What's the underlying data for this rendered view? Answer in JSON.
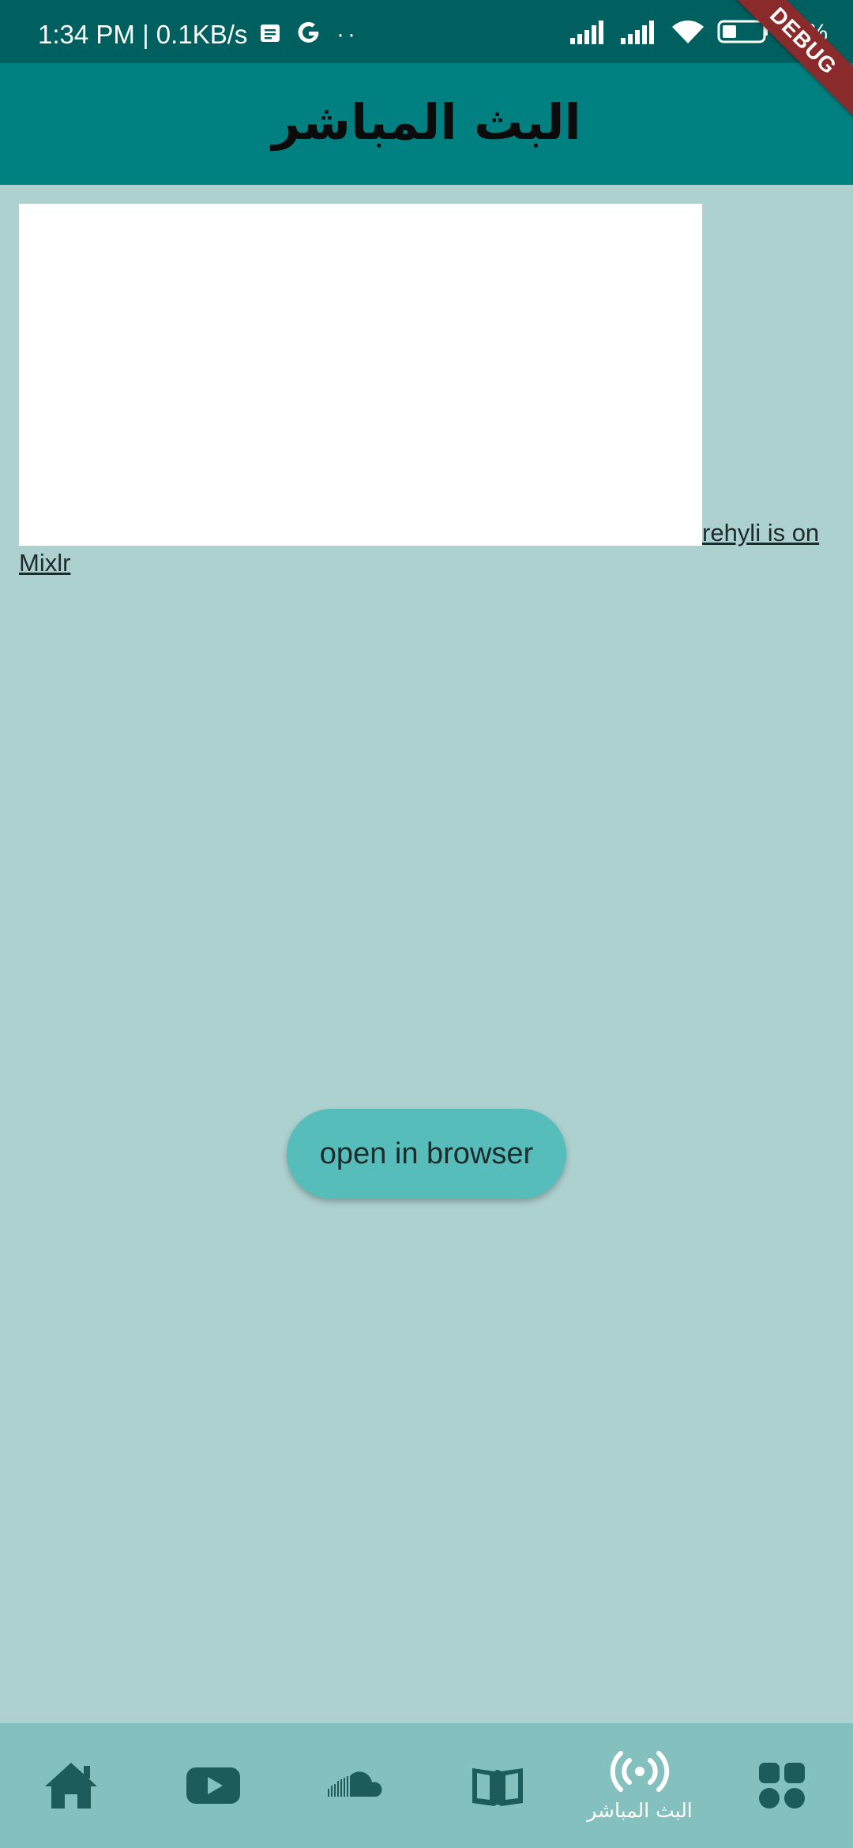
{
  "status_bar": {
    "time_speed": "1:34 PM | 0.1KB/s",
    "left_icons": [
      "message-icon",
      "google-icon",
      "more-dots-icon"
    ],
    "dots": "··",
    "right_icons": [
      "signal-icon",
      "signal-icon",
      "wifi-icon",
      "battery-icon"
    ],
    "battery_percent": "33%"
  },
  "debug_banner": "DEBUG",
  "app_bar": {
    "title": "البث المباشر"
  },
  "embed": {
    "link_text_line1": "rehyli is on",
    "link_text_line2": "Mixlr"
  },
  "open_button": {
    "label": "open in browser"
  },
  "bottom_nav": {
    "items": [
      {
        "icon": "home-icon",
        "label": ""
      },
      {
        "icon": "youtube-icon",
        "label": ""
      },
      {
        "icon": "soundcloud-icon",
        "label": ""
      },
      {
        "icon": "book-icon",
        "label": ""
      },
      {
        "icon": "live-broadcast-icon",
        "label": "البث المباشر",
        "selected": true
      },
      {
        "icon": "grid-apps-icon",
        "label": ""
      }
    ]
  },
  "colors": {
    "status_bar": "#005f5f",
    "app_bar": "#008080",
    "background": "#add1cf",
    "bottom_nav": "#83c0be",
    "button": "#57bdbb",
    "nav_icon": "#1e5c5c",
    "nav_icon_selected": "#ffffff",
    "debug": "#8b2a2a"
  }
}
